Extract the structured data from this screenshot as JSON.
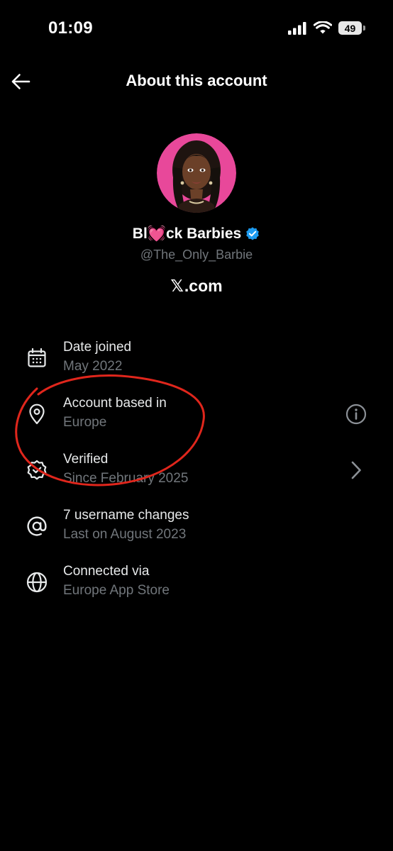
{
  "status_bar": {
    "time": "01:09",
    "battery_level": "49"
  },
  "header": {
    "title": "About this account"
  },
  "profile": {
    "display_name_prefix": "Bl",
    "display_name_emoji": "💓",
    "display_name_suffix": "ck Barbies",
    "handle": "@The_Only_Barbie",
    "site_logo": "𝕏",
    "site_suffix": ".com",
    "verified_color": "#1d9bf0"
  },
  "info": {
    "date_joined": {
      "title": "Date joined",
      "value": "May 2022",
      "icon": "calendar-icon"
    },
    "based_in": {
      "title": "Account based in",
      "value": "Europe",
      "icon": "location-pin-icon",
      "trailing_icon": "info-icon"
    },
    "verified": {
      "title": "Verified",
      "value": "Since February 2025",
      "icon": "verified-badge-outline-icon",
      "trailing_icon": "chevron-right-icon"
    },
    "username_changes": {
      "title": "7 username changes",
      "value": "Last on August 2023",
      "icon": "at-sign-icon"
    },
    "connected_via": {
      "title": "Connected via",
      "value": "Europe App Store",
      "icon": "globe-icon"
    }
  },
  "annotation": {
    "color": "#e0261c",
    "shape": "hand-drawn circle around Account based in"
  },
  "colors": {
    "background": "#000000",
    "primary_text": "#e7e9ea",
    "secondary_text": "#71767b",
    "avatar_ring": "#e8489a"
  }
}
